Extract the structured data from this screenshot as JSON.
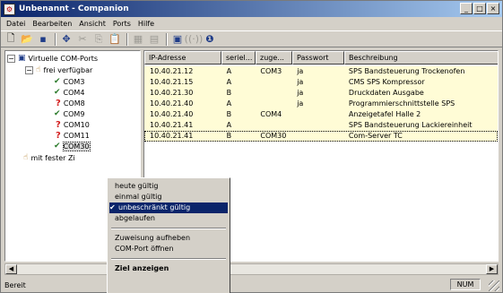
{
  "window": {
    "title": "Unbenannt - Companion",
    "controls": [
      "_",
      "□",
      "×"
    ]
  },
  "menu": [
    "Datei",
    "Bearbeiten",
    "Ansicht",
    "Ports",
    "Hilfe"
  ],
  "toolbar": {
    "icons": [
      "new-icon",
      "open-icon",
      "save-icon",
      "move-icon",
      "cut-icon",
      "copy-icon",
      "paste-icon",
      "properties-icon",
      "settings-icon",
      "computer-icon",
      "signal-icon",
      "info-icon"
    ]
  },
  "tree": {
    "root": "Virtuelle COM-Ports",
    "group_free": "frei verfügbar",
    "ports": [
      {
        "label": "COM3",
        "state": "check"
      },
      {
        "label": "COM4",
        "state": "check"
      },
      {
        "label": "COM8",
        "state": "question"
      },
      {
        "label": "COM9",
        "state": "check"
      },
      {
        "label": "COM10",
        "state": "question"
      },
      {
        "label": "COM11",
        "state": "question"
      },
      {
        "label": "COM30",
        "state": "check"
      }
    ],
    "group_fixed": "mit fester Zi"
  },
  "list": {
    "columns": [
      "IP-Adresse",
      "seriel...",
      "zuge...",
      "Passwort",
      "Beschreibung"
    ],
    "rows": [
      [
        "10.40.21.12",
        "A",
        "COM3",
        "ja",
        "SPS Bandsteuerung Trockenofen"
      ],
      [
        "10.40.21.15",
        "A",
        "",
        "ja",
        "CMS SPS Kompressor"
      ],
      [
        "10.40.21.30",
        "B",
        "",
        "ja",
        "Druckdaten Ausgabe"
      ],
      [
        "10.40.21.40",
        "A",
        "",
        "ja",
        "Programmierschnittstelle SPS"
      ],
      [
        "10.40.21.40",
        "B",
        "COM4",
        "",
        "Anzeigetafel Halle 2"
      ],
      [
        "10.40.21.41",
        "A",
        "",
        "",
        "SPS Bandsteuerung Lackiereinheit"
      ],
      [
        "10.40.21.41",
        "B",
        "COM30",
        "",
        "Com-Server TC"
      ]
    ]
  },
  "context_menu": {
    "items": [
      "heute gültig",
      "einmal gültig",
      "unbeschränkt gültig",
      "abgelaufen"
    ],
    "checked": "unbeschränkt gültig",
    "actions": [
      "Zuweisung aufheben",
      "COM-Port öffnen"
    ],
    "default_action": "Ziel anzeigen"
  },
  "status": {
    "text": "Bereit",
    "num": "NUM"
  },
  "colors": {
    "title_start": "#0a246a",
    "title_end": "#a6caf0",
    "row_bg": "#fffcd6",
    "highlight": "#0a246a"
  }
}
